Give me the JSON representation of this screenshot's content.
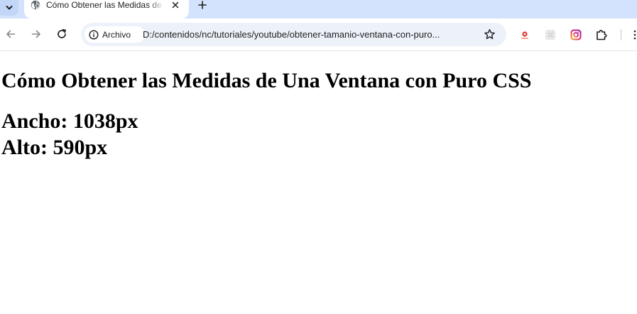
{
  "browser": {
    "tab": {
      "title": "Cómo Obtener las Medidas de Una Ventana con Puro CSS"
    },
    "address_bar": {
      "chip_label": "Archivo",
      "url": "D:/contenidos/nc/tutoriales/youtube/obtener-tamanio-ventana-con-puro..."
    },
    "colors": {
      "tabstrip": "#d3e3fd",
      "omnibox": "#edf2fa"
    }
  },
  "page": {
    "heading": "Cómo Obtener las Medidas de Una Ventana con Puro CSS",
    "width_text": "Ancho: 1038px",
    "height_text": "Alto: 590px"
  }
}
